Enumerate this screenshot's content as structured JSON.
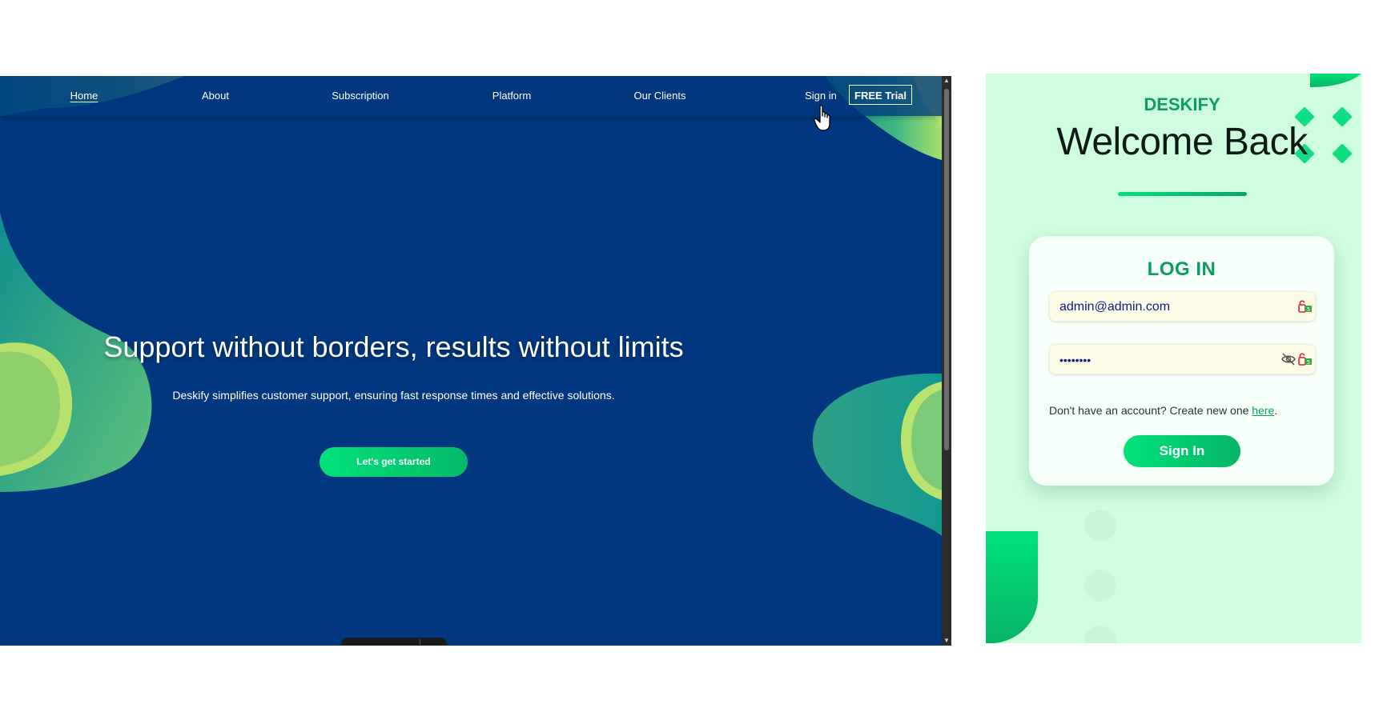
{
  "site": {
    "nav": {
      "home": "Home",
      "about": "About",
      "subscription": "Subscription",
      "platform": "Platform",
      "clients": "Our Clients",
      "signin": "Sign in",
      "trial": "FREE Trial"
    },
    "hero": {
      "title": "Support without borders, results without limits",
      "subtitle": "Deskify simplifies customer support, ensuring fast response times and effective solutions.",
      "cta": "Let's get started"
    },
    "colors": {
      "background": "#00377e",
      "accent": "#00e27a"
    }
  },
  "login": {
    "brand": "DESKIFY",
    "welcome": "Welcome Back",
    "card_title": "LOG IN",
    "email_value": "admin@admin.com",
    "password_value": "••••••••",
    "signup_prefix": "Don't have an account? Create new one ",
    "signup_link": "here",
    "signup_suffix": ".",
    "submit": "Sign In",
    "colors": {
      "background": "#cffddf",
      "accent": "#0b9f5a"
    }
  }
}
